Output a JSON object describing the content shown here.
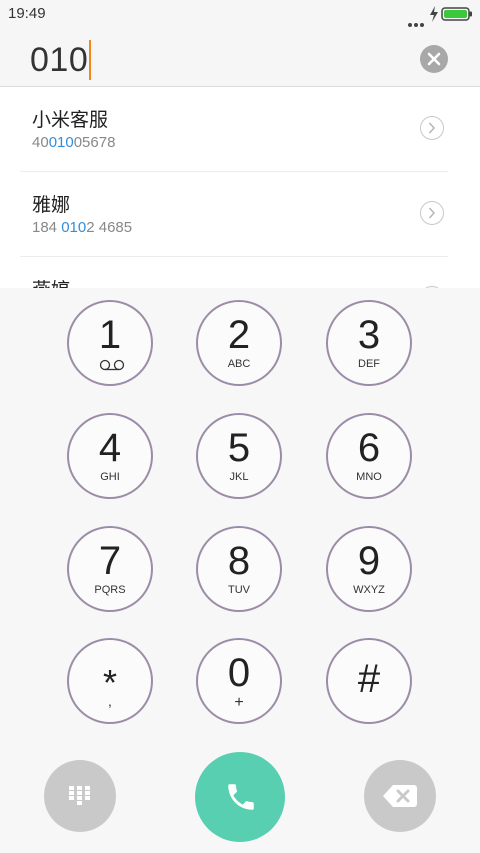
{
  "status_bar": {
    "time": "19:49",
    "battery_color": "#3cc83c"
  },
  "dial_input": {
    "number": "010",
    "caret_color": "#f08a1a"
  },
  "contacts": [
    {
      "name": "小米客服",
      "number_pre": "40",
      "number_match": "010",
      "number_post": "05678"
    },
    {
      "name": "雅娜",
      "number_pre": "184 ",
      "number_match": "010",
      "number_post": "2 4685"
    },
    {
      "name": "燕婷",
      "number_pre": "",
      "number_match": "",
      "number_post": ""
    }
  ],
  "keypad": {
    "keys": [
      {
        "digit": "1",
        "letters": "",
        "icon": "voicemail-icon"
      },
      {
        "digit": "2",
        "letters": "ABC"
      },
      {
        "digit": "3",
        "letters": "DEF"
      },
      {
        "digit": "4",
        "letters": "GHI"
      },
      {
        "digit": "5",
        "letters": "JKL"
      },
      {
        "digit": "6",
        "letters": "MNO"
      },
      {
        "digit": "7",
        "letters": "PQRS"
      },
      {
        "digit": "8",
        "letters": "TUV"
      },
      {
        "digit": "9",
        "letters": "WXYZ"
      },
      {
        "digit": "*",
        "letters": ","
      },
      {
        "digit": "0",
        "letters": "+"
      },
      {
        "digit": "#",
        "letters": ""
      }
    ],
    "key_border_color": "#9c8ca8",
    "highlight_color": "#2f8ede"
  },
  "bottom_bar": {
    "dialpad_icon": "dialpad-grid-icon",
    "call_icon": "phone-handset-icon",
    "call_color": "#58cfb0",
    "backspace_icon": "backspace-icon"
  }
}
